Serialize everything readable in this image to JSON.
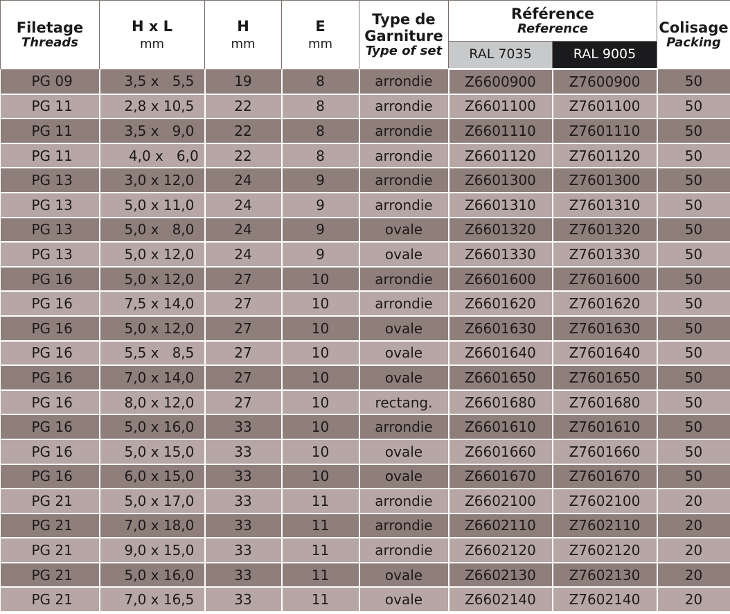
{
  "header": {
    "threads_fr": "Filetage",
    "threads_en": "Threads",
    "hxl": "H x L",
    "hxl_unit": "mm",
    "h": "H",
    "h_unit": "mm",
    "e": "E",
    "e_unit": "mm",
    "type_fr_1": "Type de",
    "type_fr_2": "Garniture",
    "type_en": "Type of set",
    "ref_fr": "Référence",
    "ref_en": "Reference",
    "ral_light": "RAL 7035",
    "ral_dark": "RAL 9005",
    "packing_fr": "Colisage",
    "packing_en": "Packing"
  },
  "colors": {
    "row_dark": "#8e7f7b",
    "row_light": "#b6a7a5",
    "ral_light_bg": "#c8c9cb",
    "ral_dark_bg": "#1b1a1c"
  },
  "rows": [
    {
      "thread": "PG 09",
      "hxl": "3,5 x   5,5",
      "h": "19",
      "e": "8",
      "type": "arrondie",
      "ref_light": "Z6600900",
      "ref_dark": "Z7600900",
      "packing": "50"
    },
    {
      "thread": "PG 11",
      "hxl": "2,8 x 10,5",
      "h": "22",
      "e": "8",
      "type": "arrondie",
      "ref_light": "Z6601100",
      "ref_dark": "Z7601100",
      "packing": "50"
    },
    {
      "thread": "PG 11",
      "hxl": "3,5 x   9,0",
      "h": "22",
      "e": "8",
      "type": "arrondie",
      "ref_light": "Z6601110",
      "ref_dark": "Z7601110",
      "packing": "50"
    },
    {
      "thread": "PG 11",
      "hxl": " 4,0 x   6,0",
      "h": "22",
      "e": "8",
      "type": "arrondie",
      "ref_light": "Z6601120",
      "ref_dark": "Z7601120",
      "packing": "50"
    },
    {
      "thread": "PG 13",
      "hxl": "3,0 x 12,0",
      "h": "24",
      "e": "9",
      "type": "arrondie",
      "ref_light": "Z6601300",
      "ref_dark": "Z7601300",
      "packing": "50"
    },
    {
      "thread": "PG 13",
      "hxl": "5,0 x 11,0",
      "h": "24",
      "e": "9",
      "type": "arrondie",
      "ref_light": "Z6601310",
      "ref_dark": "Z7601310",
      "packing": "50"
    },
    {
      "thread": "PG 13",
      "hxl": "5,0 x   8,0",
      "h": "24",
      "e": "9",
      "type": "ovale",
      "ref_light": "Z6601320",
      "ref_dark": "Z7601320",
      "packing": "50"
    },
    {
      "thread": "PG 13",
      "hxl": "5,0 x 12,0",
      "h": "24",
      "e": "9",
      "type": "ovale",
      "ref_light": "Z6601330",
      "ref_dark": "Z7601330",
      "packing": "50"
    },
    {
      "thread": "PG 16",
      "hxl": "5,0 x 12,0",
      "h": "27",
      "e": "10",
      "type": "arrondie",
      "ref_light": "Z6601600",
      "ref_dark": "Z7601600",
      "packing": "50"
    },
    {
      "thread": "PG 16",
      "hxl": "7,5 x 14,0",
      "h": "27",
      "e": "10",
      "type": "arrondie",
      "ref_light": "Z6601620",
      "ref_dark": "Z7601620",
      "packing": "50"
    },
    {
      "thread": "PG 16",
      "hxl": "5,0 x 12,0",
      "h": "27",
      "e": "10",
      "type": "ovale",
      "ref_light": "Z6601630",
      "ref_dark": "Z7601630",
      "packing": "50"
    },
    {
      "thread": "PG 16",
      "hxl": "5,5 x   8,5",
      "h": "27",
      "e": "10",
      "type": "ovale",
      "ref_light": "Z6601640",
      "ref_dark": "Z7601640",
      "packing": "50"
    },
    {
      "thread": "PG 16",
      "hxl": "7,0 x 14,0",
      "h": "27",
      "e": "10",
      "type": "ovale",
      "ref_light": "Z6601650",
      "ref_dark": "Z7601650",
      "packing": "50"
    },
    {
      "thread": "PG 16",
      "hxl": "8,0 x 12,0",
      "h": "27",
      "e": "10",
      "type": "rectang.",
      "ref_light": "Z6601680",
      "ref_dark": "Z7601680",
      "packing": "50"
    },
    {
      "thread": "PG 16",
      "hxl": "5,0 x 16,0",
      "h": "33",
      "e": "10",
      "type": "arrondie",
      "ref_light": "Z6601610",
      "ref_dark": "Z7601610",
      "packing": "50"
    },
    {
      "thread": "PG 16",
      "hxl": "5,0 x 15,0",
      "h": "33",
      "e": "10",
      "type": "ovale",
      "ref_light": "Z6601660",
      "ref_dark": "Z7601660",
      "packing": "50"
    },
    {
      "thread": "PG 16",
      "hxl": "6,0 x 15,0",
      "h": "33",
      "e": "10",
      "type": "ovale",
      "ref_light": "Z6601670",
      "ref_dark": "Z7601670",
      "packing": "50"
    },
    {
      "thread": "PG 21",
      "hxl": "5,0 x 17,0",
      "h": "33",
      "e": "11",
      "type": "arrondie",
      "ref_light": "Z6602100",
      "ref_dark": "Z7602100",
      "packing": "20"
    },
    {
      "thread": "PG 21",
      "hxl": "7,0 x 18,0",
      "h": "33",
      "e": "11",
      "type": "arrondie",
      "ref_light": "Z6602110",
      "ref_dark": "Z7602110",
      "packing": "20"
    },
    {
      "thread": "PG 21",
      "hxl": "9,0 x 15,0",
      "h": "33",
      "e": "11",
      "type": "arrondie",
      "ref_light": "Z6602120",
      "ref_dark": "Z7602120",
      "packing": "20"
    },
    {
      "thread": "PG 21",
      "hxl": "5,0 x 16,0",
      "h": "33",
      "e": "11",
      "type": "ovale",
      "ref_light": "Z6602130",
      "ref_dark": "Z7602130",
      "packing": "20"
    },
    {
      "thread": "PG 21",
      "hxl": "7,0 x 16,5",
      "h": "33",
      "e": "11",
      "type": "ovale",
      "ref_light": "Z6602140",
      "ref_dark": "Z7602140",
      "packing": "20"
    }
  ]
}
